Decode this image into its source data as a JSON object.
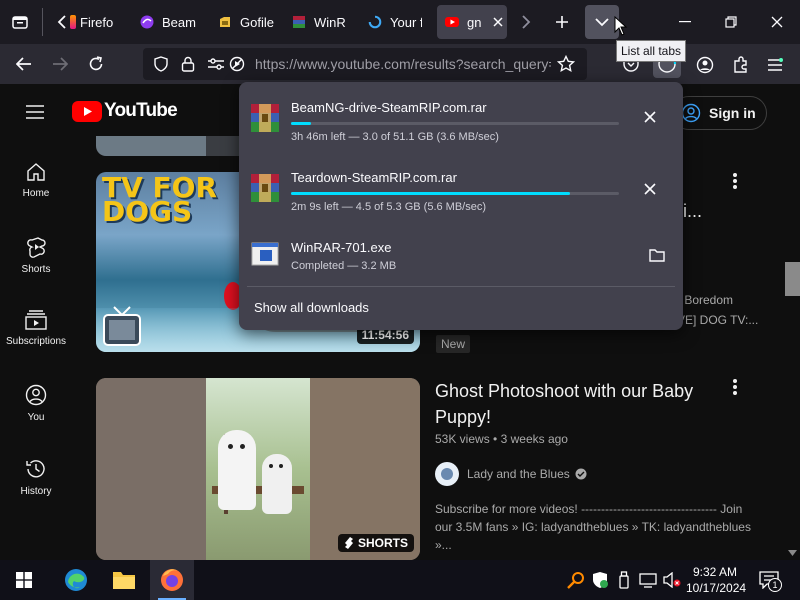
{
  "tabs": [
    {
      "label": "Firefo",
      "fav": "firefox"
    },
    {
      "label": "Beam",
      "fav": "beam"
    },
    {
      "label": "Gofile",
      "fav": "gofile"
    },
    {
      "label": "WinR",
      "fav": "winrar"
    },
    {
      "label": "Your f",
      "fav": "spinner"
    },
    {
      "label": "gn",
      "fav": "youtube"
    }
  ],
  "tooltip": "List all tabs",
  "url": "https://www.youtube.com/results?search_query=",
  "youtube": {
    "logo_text": "YouTube",
    "sign_in": "Sign in",
    "sidebar": [
      "Home",
      "Shorts",
      "Subscriptions",
      "You",
      "History"
    ],
    "video1": {
      "thumb_text": "TV FOR DOGS",
      "duration": "11:54:56",
      "title_tail": "i...",
      "desc1": "- Boredom",
      "desc2": "VE] DOG TV:...",
      "badge": "New"
    },
    "video2": {
      "title": "Ghost Photoshoot with our Baby Puppy!",
      "views": "53K views",
      "age": "3 weeks ago",
      "channel": "Lady and the Blues",
      "desc": "Subscribe for more videos! ---------------------------------- Join our 3.5M fans » IG: ladyandtheblues » TK: ladyandtheblues »...",
      "shorts_label": "SHORTS"
    }
  },
  "downloads": {
    "items": [
      {
        "name": "BeamNG-drive-SteamRIP.com.rar",
        "status": "3h 46m left — 3.0 of 51.1 GB (3.6 MB/sec)",
        "progress": 0.06
      },
      {
        "name": "Teardown-SteamRIP.com.rar",
        "status": "2m 9s left — 4.5 of 5.3 GB (5.6 MB/sec)",
        "progress": 0.85
      },
      {
        "name": "WinRAR-701.exe",
        "status": "Completed — 3.2 MB"
      }
    ],
    "show_all": "Show all downloads"
  },
  "taskbar": {
    "time": "9:32 AM",
    "date": "10/17/2024",
    "notif_count": "1"
  },
  "colors": {
    "accent": "#00ddff",
    "youtube_red": "#ff0000",
    "panel_bg": "#42414d"
  }
}
